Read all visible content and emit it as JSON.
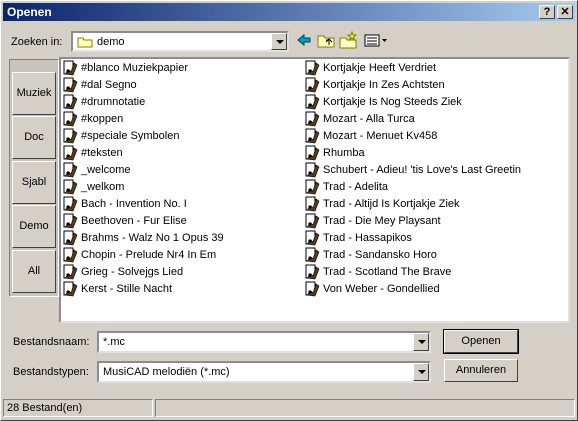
{
  "window": {
    "title": "Openen",
    "help_button": "?",
    "close_button": "✕"
  },
  "lookin": {
    "label": "Zoeken in:",
    "value": "demo",
    "toolbar_icons": [
      "back-icon",
      "up-folder-icon",
      "new-folder-icon",
      "view-menu-icon"
    ]
  },
  "places": [
    {
      "label": "Muziek"
    },
    {
      "label": "Doc"
    },
    {
      "label": "Sjabl"
    },
    {
      "label": "Demo"
    },
    {
      "label": "All"
    }
  ],
  "files_col1": [
    "#blanco Muziekpapier",
    "#dal Segno",
    "#drumnotatie",
    "#koppen",
    "#speciale Symbolen",
    "#teksten",
    "_welcome",
    "_welkom",
    "Bach - Invention No. I",
    "Beethoven - Fur Elise",
    "Brahms - Walz No 1 Opus 39",
    "Chopin - Prelude Nr4 In Em",
    "Grieg - Solvejgs Lied",
    "Kerst - Stille Nacht"
  ],
  "files_col2": [
    "Kortjakje Heeft Verdriet",
    "Kortjakje In Zes Achtsten",
    "Kortjakje Is Nog Steeds Ziek",
    "Mozart - Alla Turca",
    "Mozart - Menuet Kv458",
    "Rhumba",
    "Schubert - Adieu! 'tis Love's Last Greetin",
    "Trad - Adelita",
    "Trad - Altijd Is Kortjakje Ziek",
    "Trad - Die Mey Playsant",
    "Trad - Hassapikos",
    "Trad - Sandansko Horo",
    "Trad - Scotland The Brave",
    "Von Weber - Gondellied"
  ],
  "filename": {
    "label": "Bestandsnaam:",
    "value": "*.mc"
  },
  "filetype": {
    "label": "Bestandstypen:",
    "value": "MusiCAD melodiën (*.mc)"
  },
  "buttons": {
    "open": "Openen",
    "cancel": "Annuleren"
  },
  "status": {
    "count": "28 Bestand(en)"
  }
}
